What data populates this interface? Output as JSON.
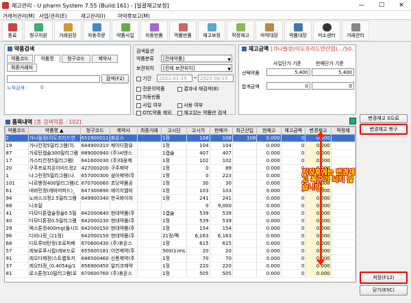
{
  "window": {
    "title": "재고관리 - U pharm System 7.55 (Build:161) - [일괄재고보정]",
    "min": "—",
    "max": "☐",
    "close": "✕"
  },
  "menu": [
    "거래처관리(M)",
    "사업/관리(E)",
    "재고관리(I)",
    "마약류보고(M)"
  ],
  "toolbar": [
    "종료",
    "청구지원",
    "거래원장",
    "자동주문",
    "약품사입",
    "자동반품",
    "약품반품",
    "재고보정",
    "적정재고",
    "마약대장",
    "약품대장",
    "미소센터",
    "거래관리"
  ],
  "drug_search": {
    "title": "약품검색",
    "tabs": [
      "약품코드",
      "약품명",
      "청구코드",
      "제약사",
      "최종거래처"
    ],
    "active_tab": "약품명",
    "search_button": "검색(F2)",
    "cumulative_label": "누적검색 :",
    "cumulative_value": "0"
  },
  "options": {
    "title": "검색옵션",
    "category_label": "약품분류",
    "category_value": "[전체약품]",
    "location_label": "보관위치",
    "location_value": "[전체 보관위치]",
    "period_label": "기간",
    "date_from": "2022-01-15",
    "date_sep": "~",
    "date_to": "2022-04-15",
    "checks": [
      {
        "label": "전문의약품",
        "on": false
      },
      {
        "label": "결과내 재검색(B)",
        "on": false
      },
      {
        "label": "자동반품",
        "on": false
      },
      {
        "label": "사입 여부",
        "on": false
      },
      {
        "label": "사용 여부",
        "on": false
      },
      {
        "label": "OTC약품 제외",
        "on": false
      },
      {
        "label": "재고있는 약품만 검색",
        "on": false
      }
    ]
  },
  "stock_amount": {
    "title": "재고금액",
    "subtitle": "[가나필정(이도프리드연산염).../50.",
    "col1": "사입단가 기준",
    "col2": "판매단가 기준",
    "row1": "선택약품",
    "row1_v1": "5,400",
    "row1_v2": "5,400",
    "row2": "합계금액",
    "row2_v1": "0",
    "row2_v2": "0"
  },
  "list": {
    "title": "품목내역",
    "count_text": "[총 검색약품 : 102]",
    "headers": [
      "약품코드",
      "약품명 ▲",
      "청구코드",
      "제약사",
      "최종거래",
      "고시단",
      "고시가",
      "판매가",
      "최근산입",
      "현재고",
      "재고금액",
      "변경재고",
      "적정재"
    ],
    "rows": [
      [
        "2",
        "가나필정(이도프리드연",
        "651900011",
        "휴온스",
        "",
        "1정",
        "108",
        "108",
        "108",
        "0.000",
        "0",
        "0.000",
        ""
      ],
      [
        "19",
        "가나칸정5밀리그램(이.",
        "644900310",
        "제이디팜유",
        "",
        "1정",
        "104",
        "104",
        "",
        "0.000",
        "0",
        "0.000",
        ""
      ],
      [
        "87",
        "가로틴캡슐300밀리그램",
        "689000940",
        "(주)씨엔스",
        "",
        "1캡슐",
        "407",
        "407",
        "",
        "0.000",
        "0",
        "0.000",
        ""
      ],
      [
        "17",
        "가스티칸정5밀리그램(",
        "641600030",
        "(주)대웅제",
        "",
        "1정",
        "102",
        "102",
        "",
        "0.000",
        "0",
        "0.000",
        ""
      ],
      [
        "20",
        "구주프로치온이미드정2",
        "427000200",
        "구주제약",
        "",
        "1정",
        "0",
        "89",
        "",
        "0.000",
        "0",
        "0.000",
        ""
      ],
      [
        "1",
        "나그린정5밀리그램(나.",
        "657000300",
        "삼아제약(주",
        "",
        "1정",
        "0",
        "223",
        "",
        "0.000",
        "0",
        "0.000",
        ""
      ],
      [
        "101",
        "나르펜정400밀리그램(C",
        "670700060",
        "초당약품공",
        "",
        "1정",
        "30",
        "30",
        "",
        "0.000",
        "0",
        "0.000",
        ""
      ],
      [
        "61",
        "네바민정(레바미피드)_",
        "647300890",
        "에이치엘비",
        "",
        "1정",
        "103",
        "103",
        "",
        "0.000",
        "0",
        "0.000",
        ""
      ],
      [
        "94",
        "노바스크정2.5밀리그램",
        "649900340",
        "한국화이자",
        "",
        "1정",
        "241",
        "241",
        "",
        "0.000",
        "0",
        "0.000",
        ""
      ],
      [
        "88",
        "니조랄",
        "",
        "",
        "",
        "",
        "0",
        "9,000",
        "",
        "0.000",
        "0",
        "0.000",
        ""
      ],
      [
        "41",
        "다모디톤캡슐정솔0.5밀",
        "642000640",
        "현대약품(주",
        "",
        "1캡슐",
        "539",
        "539",
        "",
        "0.000",
        "0",
        "0.000",
        ""
      ],
      [
        "40",
        "다모디톤정0.5밀리그램",
        "642000230",
        "현대약품(주",
        "",
        "1정",
        "539",
        "539",
        "",
        "0.000",
        "0",
        "0.000",
        ""
      ],
      [
        "29",
        "덱스톤정400mg(돌시드",
        "642000150",
        "현대약품(주",
        "",
        "1정",
        "154",
        "154",
        "",
        "0.000",
        "0",
        "0.000",
        ""
      ],
      [
        "96",
        "디비나정_(21정)",
        "642000150",
        "현대약품(주",
        "",
        "21정/팩",
        "6,163",
        "6,163",
        "",
        "0.000",
        "0",
        "0.000",
        ""
      ],
      [
        "68",
        "디트루비탄정(조로피베",
        "670600430",
        "(주)휴온스",
        "",
        "1정",
        "615",
        "615",
        "",
        "0.000",
        "0",
        "0.000",
        ""
      ],
      [
        "57",
        "레보로푸시럽(레보드로",
        "655600181",
        "이연제약(주",
        "",
        "500(1)mL",
        "20",
        "20",
        "",
        "0.000",
        "0",
        "0.000",
        ""
      ],
      [
        "91",
        "레오다제정(스트렙토키",
        "648500460",
        "신풍제약(주",
        "",
        "1정",
        "70",
        "70",
        "",
        "0.000",
        "0",
        "0.000",
        ""
      ],
      [
        "37",
        "레오타정_(0.4054g/1",
        "656900450",
        "알리코제약",
        "",
        "1정",
        "220",
        "220",
        "",
        "0.000",
        "0",
        "0.000",
        ""
      ],
      [
        "81",
        "로스톤정10밀리그램(로",
        "670600760",
        "(주)휴온스",
        "",
        "1정",
        "505",
        "505",
        "",
        "0.000",
        "0",
        "0.000",
        ""
      ]
    ]
  },
  "side": {
    "diff_button": "변경재고 0으로",
    "restore_button": "변경재고 복구",
    "save_button": "저장(F12)",
    "close_button": "닫기(ESC)"
  },
  "annotation": "저장후에는 변경재고 복구가 되지 않습니다.",
  "colors": {
    "highlight_red": "#e00000",
    "selection": "#3a6fd8",
    "annotation_text": "#ffff00"
  }
}
